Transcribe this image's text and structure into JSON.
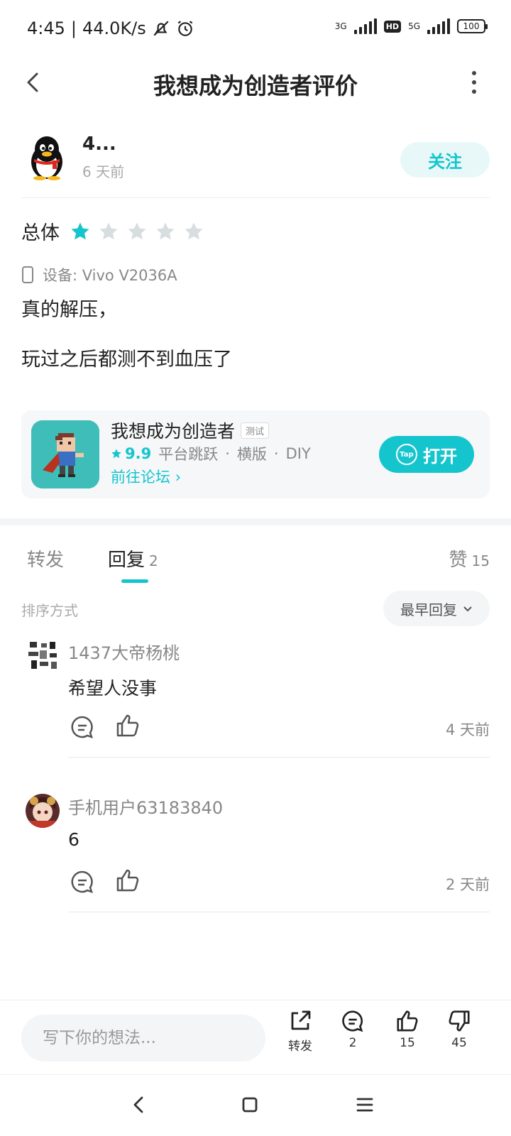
{
  "status_bar": {
    "time": "4:45",
    "speed": "44.0K/s",
    "network1": "3G",
    "hd": "HD",
    "network2": "5G",
    "battery": "100"
  },
  "header": {
    "title": "我想成为创造者评价"
  },
  "author": {
    "name": "4...",
    "time": "6 天前",
    "follow_label": "关注"
  },
  "review": {
    "overall_label": "总体",
    "rating": 1,
    "rating_max": 5,
    "device": "设备: Vivo V2036A",
    "lines": [
      "真的解压，",
      "玩过之后都测不到血压了"
    ]
  },
  "game": {
    "name": "我想成为创造者",
    "tag": "测试",
    "score": "9.9",
    "genres": [
      "平台跳跃",
      "横版",
      "DIY"
    ],
    "forum_link": "前往论坛",
    "open_label": "打开",
    "tap_label": "Tap"
  },
  "tabs": {
    "repost": "转发",
    "reply": "回复",
    "reply_count": "2",
    "like": "赞",
    "like_count": "15"
  },
  "sort": {
    "label": "排序方式",
    "value": "最早回复"
  },
  "replies": [
    {
      "name": "1437大帝杨桃",
      "text": "希望人没事",
      "time": "4 天前"
    },
    {
      "name": "手机用户63183840",
      "text": "6",
      "time": "2 天前"
    }
  ],
  "bottom": {
    "input_placeholder": "写下你的想法...",
    "repost_label": "转发",
    "comment_count": "2",
    "like_count": "15",
    "dislike_count": "45"
  },
  "colors": {
    "accent": "#15c5ce",
    "star_off": "#d8dde0"
  }
}
